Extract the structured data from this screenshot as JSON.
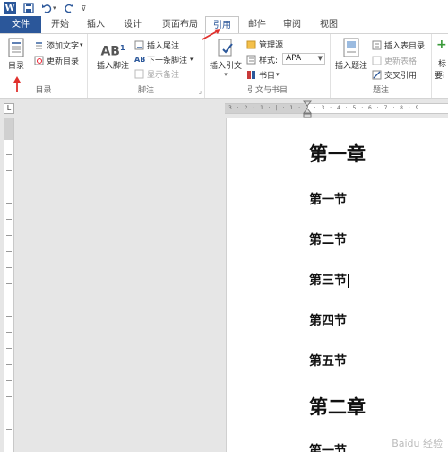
{
  "qat": {
    "app_letter": "W"
  },
  "tabs": [
    {
      "label": "文件"
    },
    {
      "label": "开始"
    },
    {
      "label": "插入"
    },
    {
      "label": "设计"
    },
    {
      "label": "页面布局"
    },
    {
      "label": "引用"
    },
    {
      "label": "邮件"
    },
    {
      "label": "审阅"
    },
    {
      "label": "视图"
    }
  ],
  "ribbon": {
    "toc_group": {
      "label": "目录",
      "toc_button": "目录",
      "add_text": "添加文字",
      "update_toc": "更新目录"
    },
    "footnote_group": {
      "label": "脚注",
      "insert_footnote": "插入脚注",
      "insert_endnote": "插入尾注",
      "next_footnote": "下一条脚注",
      "show_notes": "显示备注"
    },
    "citation_group": {
      "label": "引文与书目",
      "insert_citation": "插入引文",
      "manage_sources": "管理源",
      "style_label": "样式:",
      "style_value": "APA",
      "bibliography": "书目"
    },
    "caption_group": {
      "label": "题注",
      "insert_caption": "插入题注",
      "insert_table_of_figures": "插入表目录",
      "update_table": "更新表格",
      "cross_reference": "交叉引用"
    },
    "index_group": {
      "partial_1": "标",
      "partial_2": "要i"
    }
  },
  "ruler": {
    "tab_selector": "L",
    "numbers": "3 · 2 · 1 · | · 1 · 2 · 3 · 4 · 5 · 6 · 7 · 8 · 9"
  },
  "document": {
    "chapter1": "第一章",
    "sections": [
      "第一节",
      "第二节",
      "第三节",
      "第四节",
      "第五节"
    ],
    "chapter2": "第二章",
    "partial": "第一节"
  },
  "watermark": "Baidu 经验",
  "colors": {
    "brand": "#2b579a",
    "annotation_arrow": "#e0302c"
  }
}
